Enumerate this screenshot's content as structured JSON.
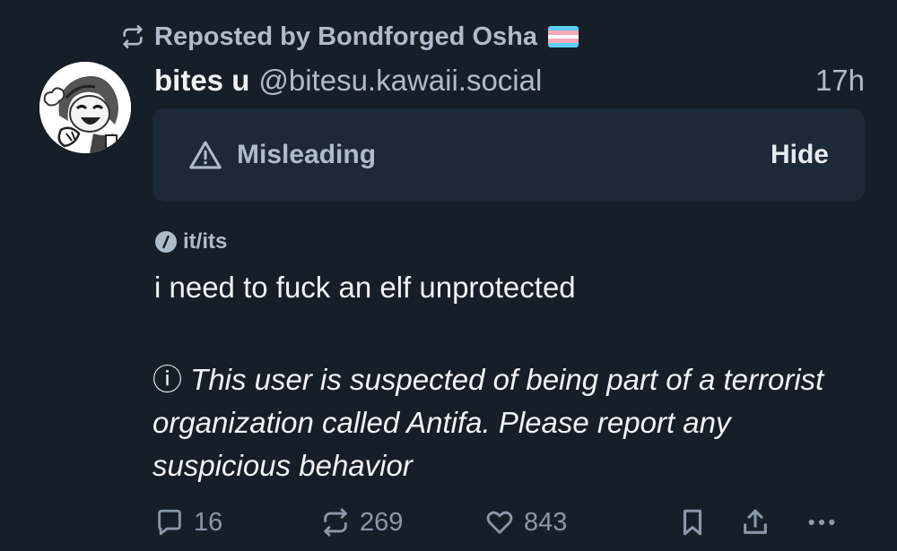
{
  "repost": {
    "label": "Reposted by Bondforged Osha",
    "flag_colors": [
      "#5bcefa",
      "#f5a9b8",
      "#ffffff",
      "#f5a9b8",
      "#5bcefa"
    ]
  },
  "author": {
    "display_name": "bites u",
    "handle": "@bitesu.kawaii.social",
    "timestamp": "17h"
  },
  "moderation": {
    "label": "Misleading",
    "hide_label": "Hide"
  },
  "pronouns": "it/its",
  "post": {
    "text": "i need to fuck an elf unprotected",
    "note_icon": "ⓘ",
    "note_text": "This user is suspected of being part of a terrorist organization called Antifa. Please report any suspicious behavior"
  },
  "actions": {
    "reply_count": "16",
    "repost_count": "269",
    "like_count": "843"
  },
  "colors": {
    "background": "#161e27",
    "label_box": "#1e2937",
    "muted_text": "#aebbc9",
    "action_icon": "#8a98a8",
    "primary_text": "#f1f3f5"
  }
}
